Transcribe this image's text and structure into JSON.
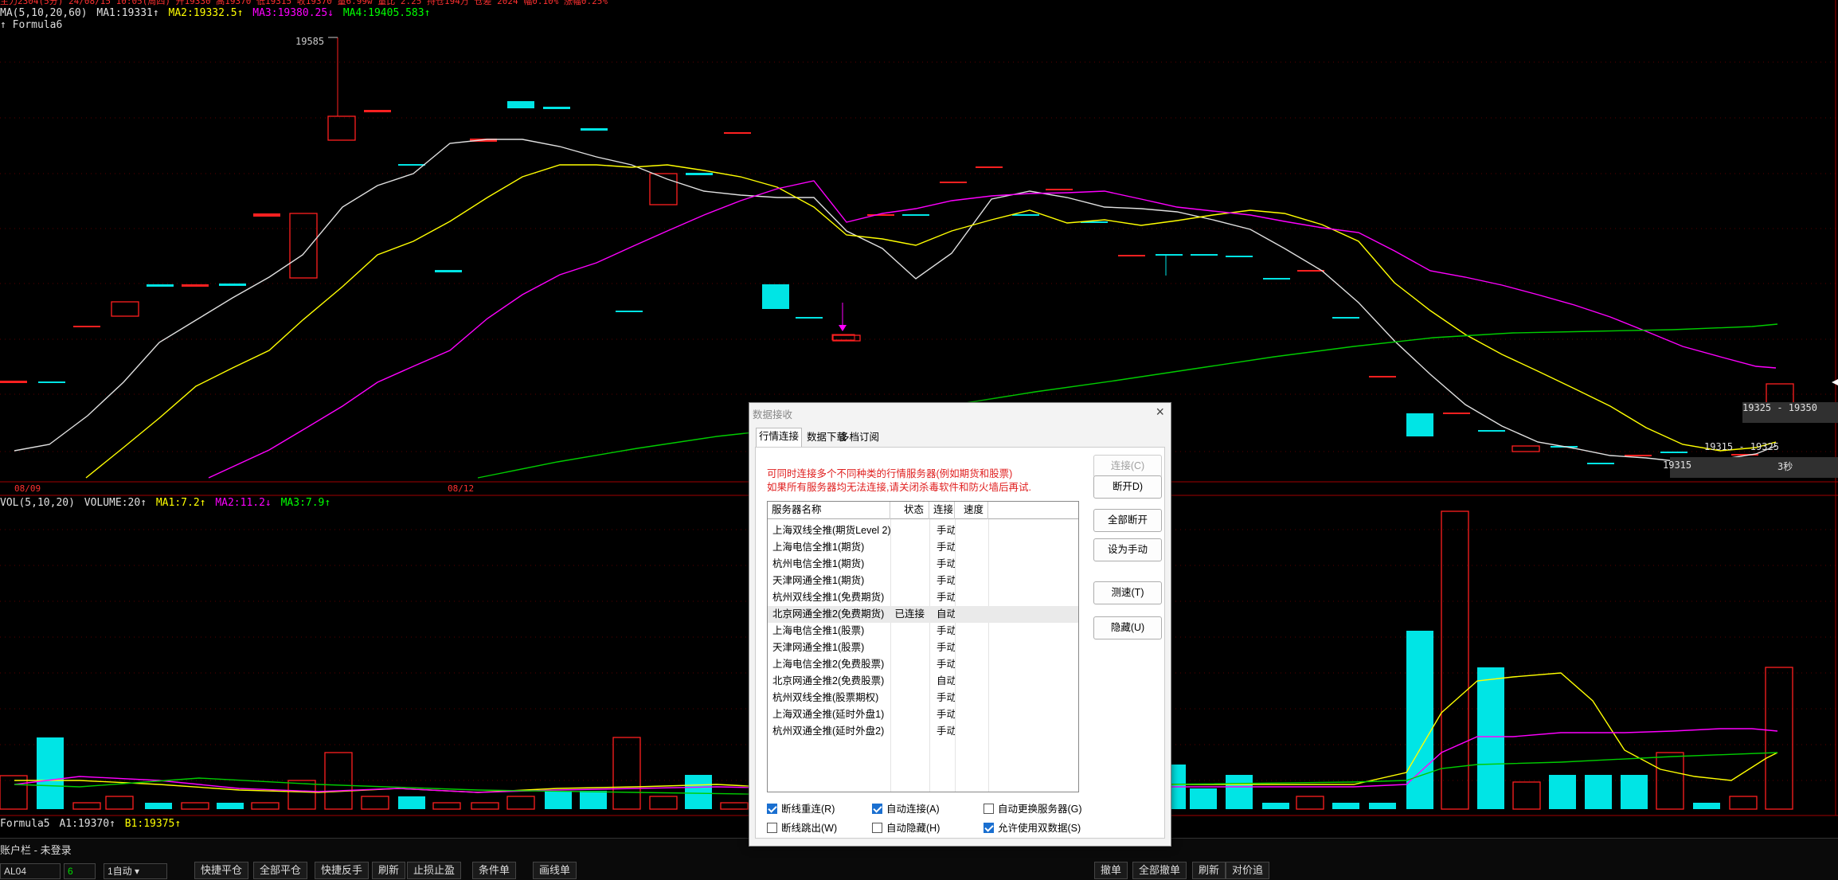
{
  "chart_header": {
    "top_strip": "主力2304(5分) 24/08/15 10:05(周四) 开19330 高19370 低19315 收19370 量6.99w 量比 2.25 持仓194万 仓差 2024 幅0.10% 涨幅0.25%",
    "ma_title": "MA(5,10,20,60)",
    "ma1": "MA1:19331↑",
    "ma2": "MA2:19332.5↑",
    "ma3": "MA3:19380.25↓",
    "ma4": "MA4:19405.583↑",
    "formula6": "↑ Formula6"
  },
  "price_labels": {
    "high": "19585",
    "range_top": "19325 - 19350",
    "range_mid": "19315 - 19325",
    "low": "19315",
    "countdown": "3秒",
    "date1": "08/09",
    "date2": "08/12"
  },
  "vol_header": {
    "title": "VOL(5,10,20)",
    "volume": "VOLUME:20↑",
    "ma1": "MA1:7.2↑",
    "ma2": "MA2:11.2↓",
    "ma3": "MA3:7.9↑"
  },
  "formula5": {
    "title": "Formula5",
    "a1": "A1:19370↑",
    "b1": "B1:19375↑"
  },
  "account": {
    "label": "账户栏",
    "status": "- 未登录"
  },
  "order_bar": {
    "code": "AL04",
    "qty": "6",
    "mode": "1自动",
    "buttons_left": [
      "快捷平仓",
      "全部平仓",
      "快捷反手",
      "刷新",
      "止损止盈",
      "条件单",
      "画线单"
    ],
    "buttons_right": [
      "撤单",
      "全部撤单",
      "刷新",
      "对价追"
    ]
  },
  "dialog": {
    "title": "数据接收",
    "tabs": [
      "行情连接",
      "数据下载",
      "多档订阅"
    ],
    "active_tab": 0,
    "note1": "可同时连接多个不同种类的行情服务器(例如期货和股票)",
    "note2": "如果所有服务器均无法连接,请关闭杀毒软件和防火墙后再试.",
    "columns": [
      "服务器名称",
      "状态",
      "连接",
      "速度"
    ],
    "rows": [
      {
        "name": "上海双线全推(期货Level 2)",
        "status": "",
        "mode": "手动",
        "speed": ""
      },
      {
        "name": "上海电信全推1(期货)",
        "status": "",
        "mode": "手动",
        "speed": ""
      },
      {
        "name": "杭州电信全推1(期货)",
        "status": "",
        "mode": "手动",
        "speed": ""
      },
      {
        "name": "天津网通全推1(期货)",
        "status": "",
        "mode": "手动",
        "speed": ""
      },
      {
        "name": "杭州双线全推1(免费期货)",
        "status": "",
        "mode": "手动",
        "speed": ""
      },
      {
        "name": "北京网通全推2(免费期货)",
        "status": "已连接",
        "mode": "自动",
        "speed": ""
      },
      {
        "name": "上海电信全推1(股票)",
        "status": "",
        "mode": "手动",
        "speed": ""
      },
      {
        "name": "天津网通全推1(股票)",
        "status": "",
        "mode": "手动",
        "speed": ""
      },
      {
        "name": "上海电信全推2(免费股票)",
        "status": "",
        "mode": "手动",
        "speed": ""
      },
      {
        "name": "北京网通全推2(免费股票)",
        "status": "",
        "mode": "自动",
        "speed": ""
      },
      {
        "name": "杭州双线全推(股票期权)",
        "status": "",
        "mode": "手动",
        "speed": ""
      },
      {
        "name": "上海双通全推(延时外盘1)",
        "status": "",
        "mode": "手动",
        "speed": ""
      },
      {
        "name": "杭州双通全推(延时外盘2)",
        "status": "",
        "mode": "手动",
        "speed": ""
      }
    ],
    "buttons": [
      "连接(C)",
      "断开D)",
      "全部断开",
      "设为手动",
      "测速(T)",
      "隐藏(U)"
    ],
    "checkboxes": [
      {
        "label": "断线重连(R)",
        "checked": true
      },
      {
        "label": "自动连接(A)",
        "checked": true
      },
      {
        "label": "自动更换服务器(G)",
        "checked": false
      },
      {
        "label": "断线跳出(W)",
        "checked": false
      },
      {
        "label": "自动隐藏(H)",
        "checked": false
      },
      {
        "label": "允许使用双数据(S)",
        "checked": true
      }
    ]
  },
  "colors": {
    "up": "#ff2020",
    "down": "#00e5e5",
    "ma1": "#e0e0e0",
    "ma2": "#ffff00",
    "ma3": "#ff00ff",
    "ma4": "#00cc00"
  }
}
